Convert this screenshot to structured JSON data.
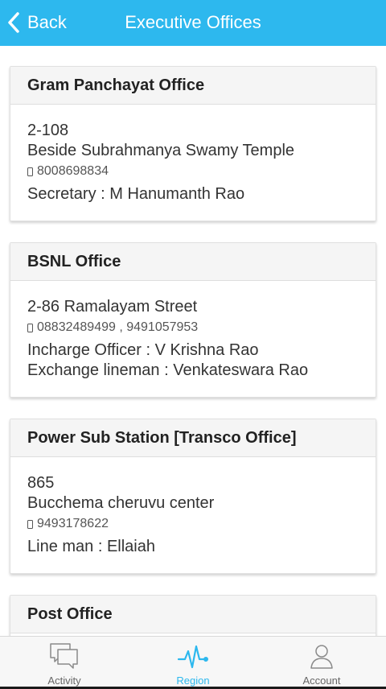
{
  "header": {
    "back_label": "Back",
    "title": "Executive Offices"
  },
  "offices": [
    {
      "name": "Gram Panchayat Office",
      "address_lines": [
        "2-108",
        "Beside Subrahmanya Swamy Temple"
      ],
      "phone": "8008698834",
      "contacts": [
        "Secretary : M Hanumanth Rao"
      ]
    },
    {
      "name": "BSNL Office",
      "address_lines": [
        "2-86 Ramalayam Street"
      ],
      "phone": "08832489499 , 9491057953",
      "contacts": [
        "Incharge Officer : V Krishna Rao",
        "Exchange lineman : Venkateswara Rao"
      ]
    },
    {
      "name": "Power Sub Station [Transco Office]",
      "address_lines": [
        "865",
        "Bucchema cheruvu center"
      ],
      "phone": "9493178622",
      "contacts": [
        "Line man : Ellaiah"
      ]
    },
    {
      "name": "Post Office",
      "address_lines": [],
      "phone": "",
      "contacts": []
    }
  ],
  "tabbar": {
    "tabs": [
      {
        "label": "Activity",
        "icon": "chat-bubbles-icon"
      },
      {
        "label": "Region",
        "icon": "pulse-icon",
        "active": true
      },
      {
        "label": "Account",
        "icon": "person-icon"
      }
    ]
  },
  "colors": {
    "accent": "#2db8ee",
    "header_bg": "#f5f5f5"
  }
}
